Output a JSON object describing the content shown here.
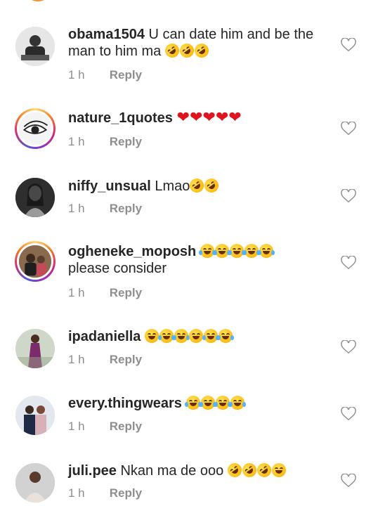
{
  "comments": [
    {
      "username": "obama1504",
      "text": "U can date him and be the man to him ma",
      "emoji": [
        "rofl",
        "rofl",
        "rofl"
      ],
      "time": "1 h",
      "reply": "Reply",
      "ring": false
    },
    {
      "username": "nature_1quotes",
      "text": "",
      "emoji": [
        "heart",
        "heart",
        "heart",
        "heart",
        "heart"
      ],
      "time": "1 h",
      "reply": "Reply",
      "ring": true
    },
    {
      "username": "niffy_unsual",
      "text": "Lmao",
      "emoji": [
        "rofl",
        "rofl"
      ],
      "time": "1 h",
      "reply": "Reply",
      "ring": false
    },
    {
      "username": "ogheneke_moposh",
      "text": "please consider",
      "emoji": [
        "joy",
        "joy",
        "joy",
        "joy",
        "joy"
      ],
      "time": "1 h",
      "reply": "Reply",
      "ring": true
    },
    {
      "username": "ipadaniella",
      "text": "",
      "emoji": [
        "grin",
        "joy",
        "joy",
        "grin",
        "joy",
        "joy"
      ],
      "time": "1 h",
      "reply": "Reply",
      "ring": false
    },
    {
      "username": "every.thingwears",
      "text": "",
      "emoji": [
        "joy",
        "joy",
        "joy",
        "joy"
      ],
      "time": "1 h",
      "reply": "Reply",
      "ring": false
    },
    {
      "username": "juli.pee",
      "text": "Nkan ma de ooo",
      "emoji": [
        "rofl",
        "rofl",
        "rofl",
        "smile"
      ],
      "time": "1 h",
      "reply": "Reply",
      "ring": false
    }
  ],
  "colors": {
    "text": "#262626",
    "meta": "#8e8e8e",
    "heart_outline": "#8e8e8e",
    "ring": "#d62976"
  }
}
